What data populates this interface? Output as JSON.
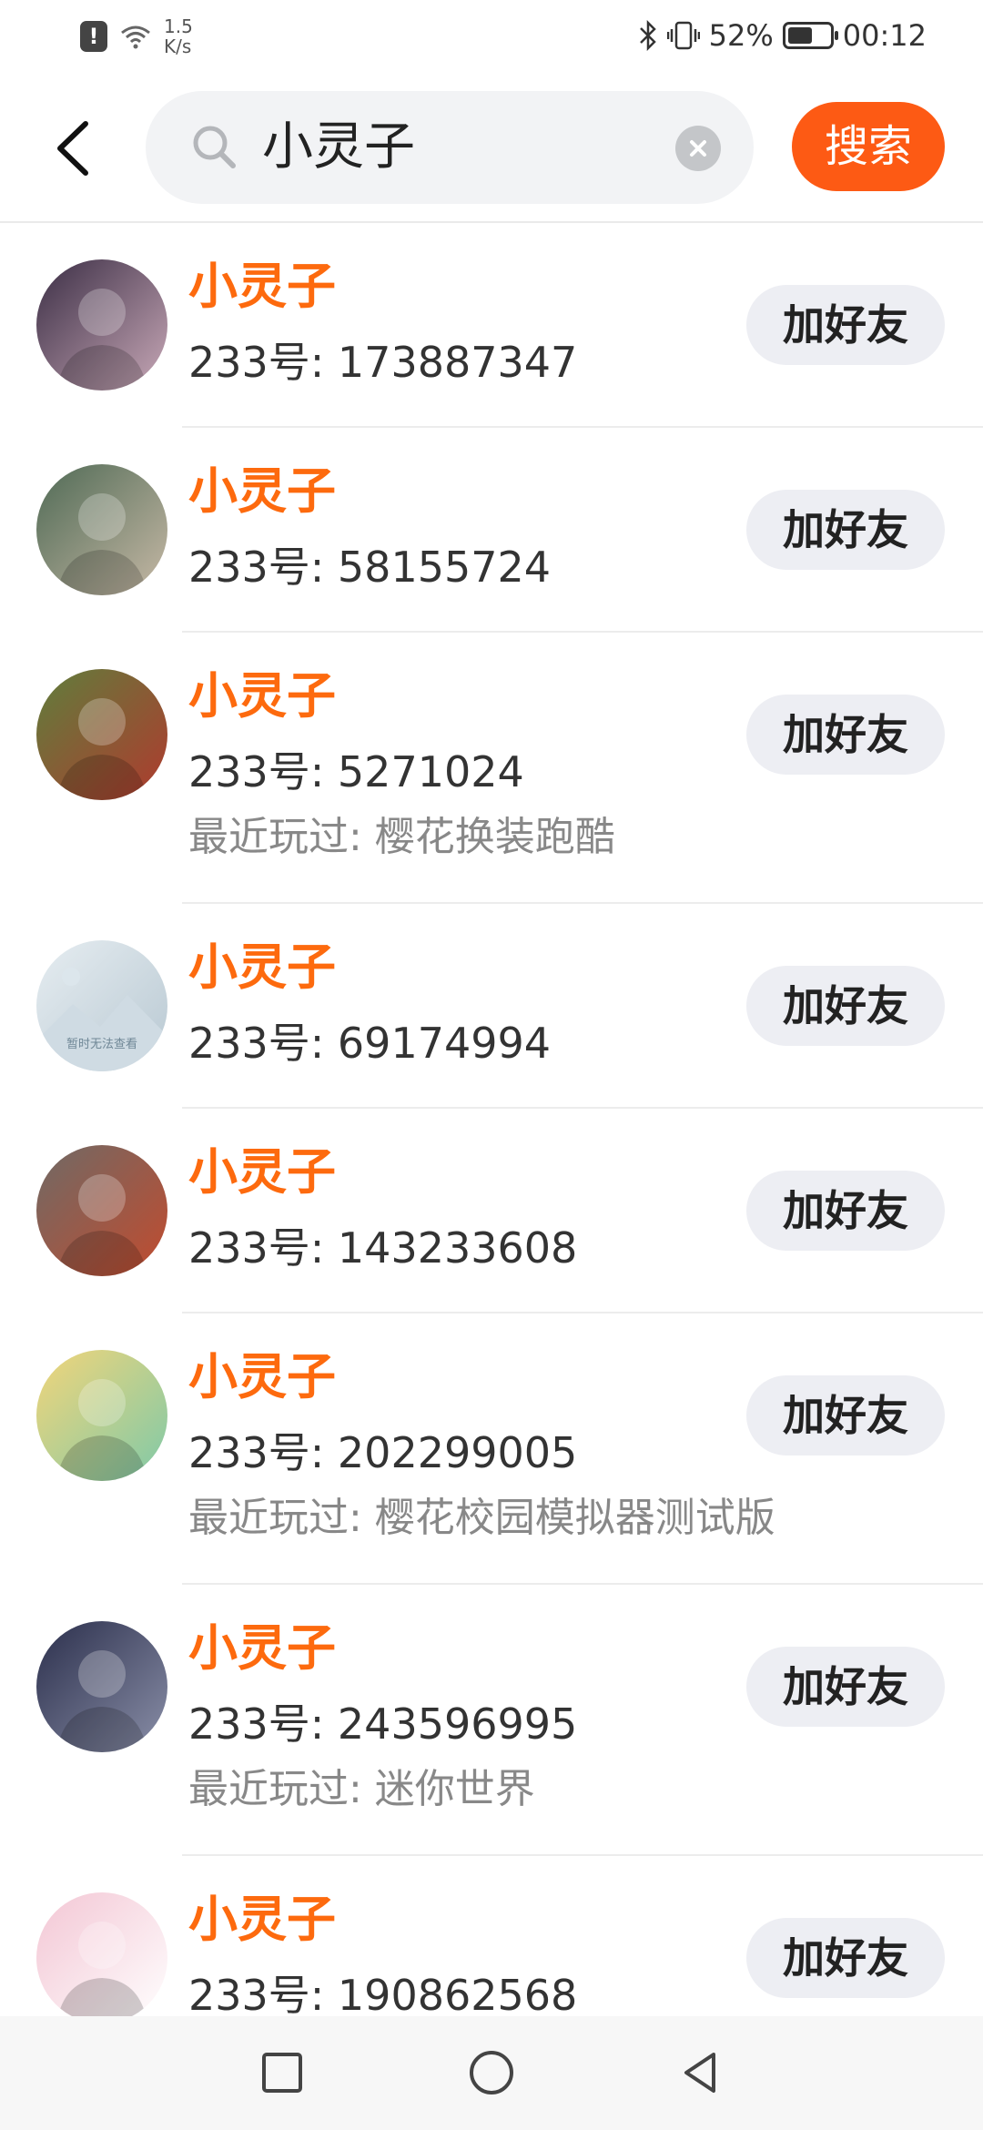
{
  "status_bar": {
    "network_speed_value": "1.5",
    "network_speed_unit": "K/s",
    "battery_percent": "52%",
    "battery_level": 0.52,
    "time": "00:12",
    "icons": [
      "alert-icon",
      "wifi-icon",
      "bluetooth-icon",
      "vibrate-icon",
      "battery-icon"
    ]
  },
  "header": {
    "search_query": "小灵子",
    "search_button_label": "搜索"
  },
  "results": [
    {
      "name": "小灵子",
      "uid": "233号: 173887347",
      "played": "",
      "add_label": "加好友",
      "avatar_colors": [
        "#3b2e45",
        "#c9a9b8"
      ]
    },
    {
      "name": "小灵子",
      "uid": "233号: 58155724",
      "played": "",
      "add_label": "加好友",
      "avatar_colors": [
        "#4f6a55",
        "#c7b9a6"
      ]
    },
    {
      "name": "小灵子",
      "uid": "233号: 5271024",
      "played": "最近玩过: 樱花换装跑酷",
      "add_label": "加好友",
      "avatar_colors": [
        "#5f7e3c",
        "#b03a2e"
      ]
    },
    {
      "name": "小灵子",
      "uid": "233号: 69174994",
      "played": "",
      "add_label": "加好友",
      "avatar_colors": [
        "#e6edf1",
        "#b8c8d2"
      ],
      "avatar_caption": "暂时无法查看"
    },
    {
      "name": "小灵子",
      "uid": "233号: 143233608",
      "played": "",
      "add_label": "加好友",
      "avatar_colors": [
        "#6f6a66",
        "#c24b2e"
      ]
    },
    {
      "name": "小灵子",
      "uid": "233号: 202299005",
      "played": "最近玩过: 樱花校园模拟器测试版",
      "add_label": "加好友",
      "avatar_colors": [
        "#f2d57a",
        "#7fc9a8"
      ]
    },
    {
      "name": "小灵子",
      "uid": "233号: 243596995",
      "played": "最近玩过: 迷你世界",
      "add_label": "加好友",
      "avatar_colors": [
        "#2b2f4c",
        "#8a8fa8"
      ]
    },
    {
      "name": "小灵子",
      "uid": "233号: 190862568",
      "played": "",
      "add_label": "加好友",
      "avatar_colors": [
        "#f3c6d4",
        "#ffffff"
      ]
    }
  ],
  "nav_bar": {
    "buttons": [
      "recents-square-icon",
      "home-circle-icon",
      "back-triangle-icon"
    ]
  },
  "colors": {
    "accent": "#fd5a14",
    "name_text": "#fd6a0e",
    "button_bg": "#edeef3",
    "search_bg": "#f2f3f5"
  }
}
